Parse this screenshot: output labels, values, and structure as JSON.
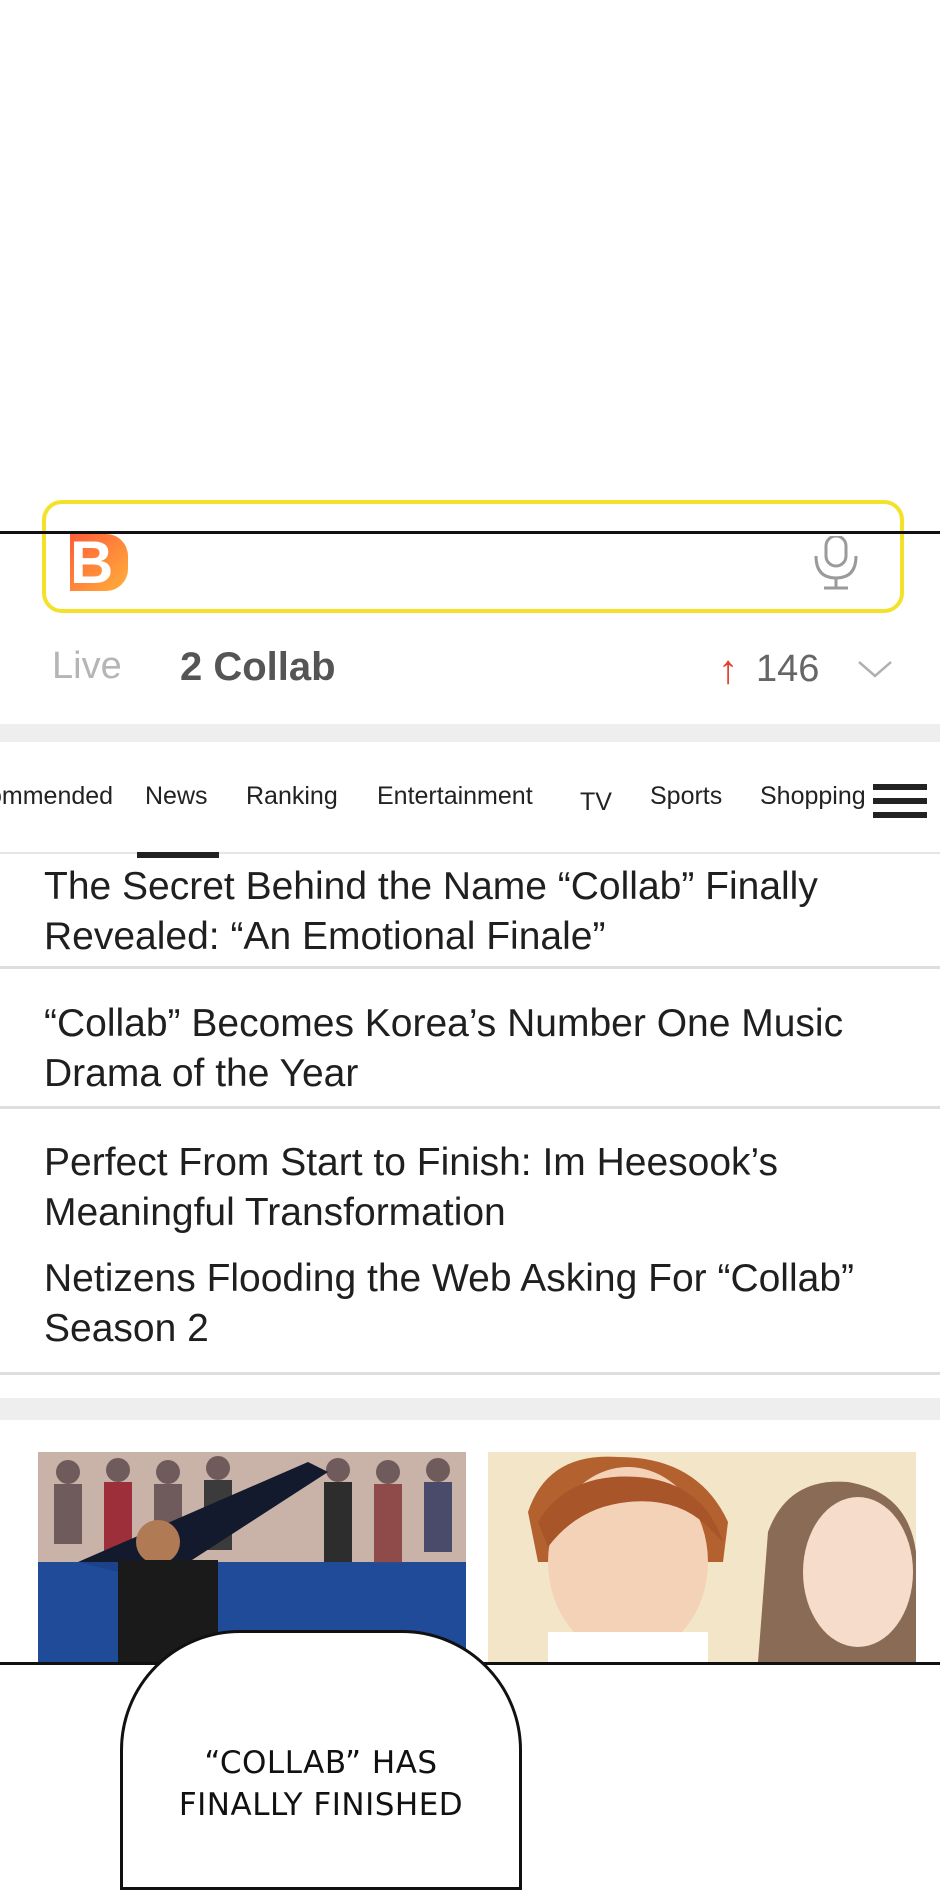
{
  "search": {
    "logo_letter": "B",
    "mic_icon": "microphone-icon"
  },
  "trending": {
    "label": "Live",
    "rank_text": "2 Collab",
    "arrow": "↑",
    "count": "146",
    "chevron_icon": "chevron-down-icon"
  },
  "tabs": {
    "items": [
      "ommended",
      "News",
      "Ranking",
      "Entertainment",
      "TV",
      "Sports",
      "Shopping"
    ],
    "active": "News",
    "menu_icon": "hamburger-menu-icon"
  },
  "news": [
    {
      "line1": "The Secret Behind the Name “Collab” Finally",
      "line2": "Revealed: “An Emotional Finale”"
    },
    {
      "line1": "“Collab” Becomes Korea’s Number One Music",
      "line2": "Drama of the Year"
    },
    {
      "line1": "Perfect From Start to Finish: Im Heesook’s",
      "line2": "Meaningful Transformation"
    },
    {
      "line1": "Netizens Flooding the Web Asking For “Collab”",
      "line2": "Season 2"
    }
  ],
  "speech_bubble": {
    "line1": "“COLLAB” HAS",
    "line2": "FINALLY FINISHED"
  },
  "colors": {
    "search_border": "#f3e12a",
    "trend_arrow": "#e43d2a",
    "logo_gradient_start": "#ff5b3a",
    "logo_gradient_end": "#ffb13a"
  }
}
